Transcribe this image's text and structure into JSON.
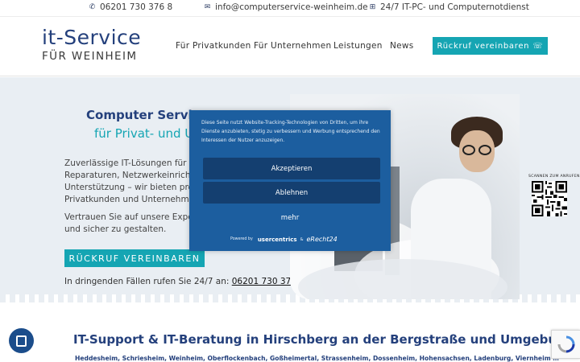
{
  "topbar": {
    "phone": "06201 730 376 8",
    "email": "info@computerservice-weinheim.de",
    "emergency": "24/7 IT-PC- und Computernotdienst"
  },
  "header": {
    "logo_line1": "it-Service",
    "logo_line2": "FÜR WEINHEIM",
    "nav": [
      "Für Privatkunden",
      "Für Unternehmen",
      "Leistungen",
      "News"
    ],
    "callback_button": "Rückruf vereinbaren"
  },
  "hero": {
    "title": "Computer Service",
    "subtitle": "für Privat- und Ur",
    "paragraph1": [
      "Zuverlässige IT-Lösungen für alle B",
      "Reparaturen, Netzwerkeinrichtung",
      "Unterstützung – wir bieten profess",
      "Privatkunden und Unternehmen."
    ],
    "paragraph2": [
      "Vertrauen Sie auf unsere Expertise",
      "und sicher zu gestalten."
    ],
    "callback_button": "RÜCKRUF VEREINBAREN",
    "urgent_text": "In dringenden Fällen rufen Sie 24/7 an: ",
    "urgent_phone": "06201 730 376 8",
    "qr_label": "SCANNEN ZUM ANRUFEN"
  },
  "consent": {
    "text": "Diese Seite nutzt Website-Tracking-Technologien von Dritten, um ihre Dienste anzubieten, stetig zu verbessern und Werbung entsprechend den Interessen der Nutzer anzuzeigen.",
    "accept": "Akzeptieren",
    "decline": "Ablehnen",
    "more": "mehr",
    "powered_by": "Powered by",
    "usercentrics": "usercentrics",
    "amp": "&",
    "erecht": "eRecht24"
  },
  "section": {
    "title": "IT-Support & IT-Beratung in Hirschberg an der Bergstraße und Umgebung",
    "towns": "Heddesheim, Schriesheim, Weinheim, Oberflockenbach, Goßheimertal, Strassenheim, Dossenheim, Hohensachsen, Ladenburg, Viernheim …"
  },
  "colors": {
    "brand_blue": "#24407c",
    "teal": "#15a5b3",
    "modal_bg": "#1c5e9f",
    "modal_button": "#143f70"
  },
  "icons": [
    "phone-icon",
    "mail-icon",
    "plus-square-icon",
    "phone-callback-icon",
    "qr-code",
    "chat-widget-icon",
    "recaptcha-icon"
  ]
}
